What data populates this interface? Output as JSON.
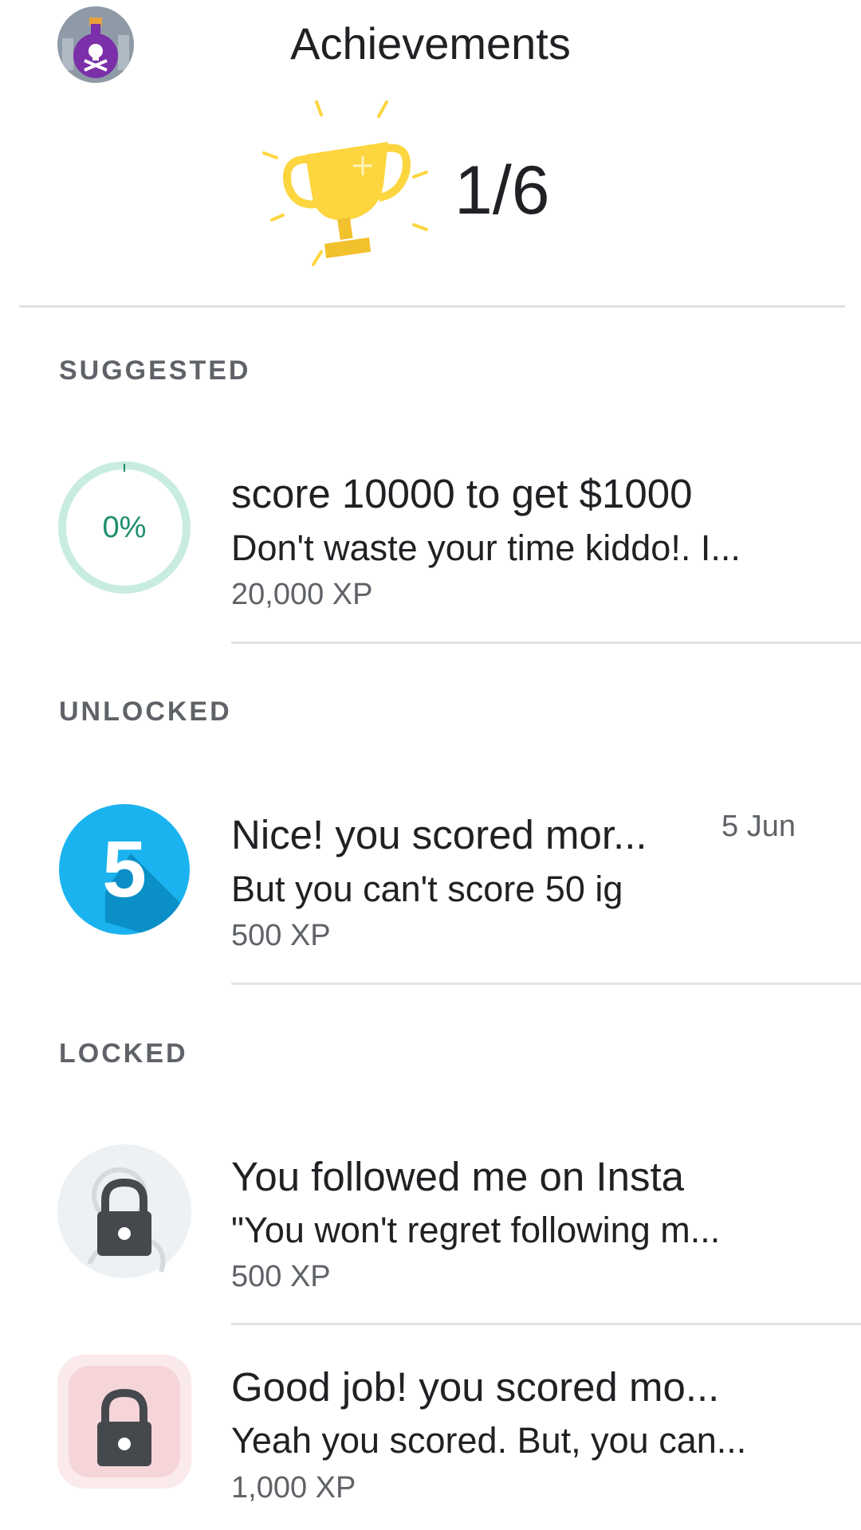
{
  "header": {
    "title": "Achievements",
    "counter": "1/6",
    "avatar_icon": "poison-bottle-avatar-icon",
    "trophy_icon": "trophy-icon"
  },
  "sections": {
    "suggested": "SUGGESTED",
    "unlocked": "UNLOCKED",
    "locked": "LOCKED"
  },
  "suggested_item": {
    "progress_label": "0%",
    "progress": 0,
    "title": "score 10000 to get $1000",
    "description": "Don't waste your time kiddo!. I...",
    "xp": "20,000 XP"
  },
  "unlocked_item": {
    "badge_number": "5",
    "title": "Nice! you scored mor...",
    "description": "But you can't score 50 ig",
    "xp": "500 XP",
    "date": "5 Jun"
  },
  "locked_items": [
    {
      "title": "You followed me on Insta",
      "description": "\"You won't regret following m...",
      "xp": "500 XP",
      "icon": "lock-icon"
    },
    {
      "title": "Good job! you scored mo...",
      "description": "Yeah you scored. But, you can...",
      "xp": "1,000 XP",
      "icon": "lock-icon"
    }
  ],
  "colors": {
    "progress_ring": "#c8ede0",
    "progress_text": "#1e8e6e",
    "badge_blue": "#1ab3ef",
    "trophy_gold": "#fcd53f",
    "lock_dark": "#45494e"
  }
}
